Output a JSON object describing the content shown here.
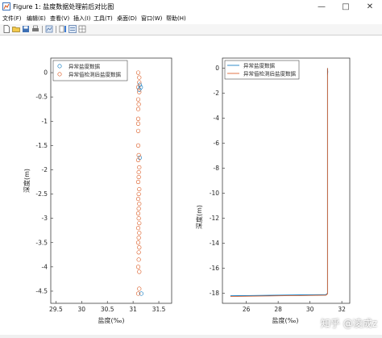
{
  "window": {
    "title": "Figure 1: 盐度数据处理前后对比图",
    "minimize": "—",
    "maximize": "□",
    "close": "✕"
  },
  "menu": [
    "文件(F)",
    "编辑(E)",
    "查看(V)",
    "插入(I)",
    "工具(T)",
    "桌面(D)",
    "窗口(W)",
    "帮助(H)"
  ],
  "toolbar_icons": [
    "new-file-icon",
    "open-folder-icon",
    "save-icon",
    "print-icon",
    "link-plot-icon",
    "insert-colorbar-icon",
    "insert-legend-icon",
    "grid-icon"
  ],
  "left_plot": {
    "xlabel": "盐度(‰)",
    "ylabel": "深度(m)",
    "xticks": [
      "29.5",
      "30",
      "30.5",
      "31",
      "31.5"
    ],
    "yticks": [
      "0",
      "-0.5",
      "-1",
      "-1.5",
      "-2",
      "-2.5",
      "-3",
      "-3.5",
      "-4",
      "-4.5"
    ],
    "legend": [
      "异常盐度数据",
      "异常值检测后盐度数据"
    ]
  },
  "right_plot": {
    "xlabel": "盐度(‰)",
    "ylabel": "深度(m)",
    "xticks": [
      "26",
      "28",
      "30",
      "32"
    ],
    "yticks": [
      "0",
      "-2",
      "-4",
      "-6",
      "-8",
      "-10",
      "-12",
      "-14",
      "-16",
      "-18"
    ],
    "legend": [
      "异常盐度数据",
      "异常值检测后盐度数据"
    ]
  },
  "watermark": "知乎 @凌成z",
  "colors": {
    "series_raw": "#0072bd",
    "series_cleaned": "#d95319",
    "axis": "#262626"
  },
  "chart_data": [
    {
      "type": "scatter",
      "xlabel": "盐度(‰)",
      "ylabel": "深度(m)",
      "xlim": [
        29.4,
        31.75
      ],
      "ylim": [
        -4.75,
        0.3
      ],
      "legend_position": "top-left",
      "series": [
        {
          "name": "异常盐度数据",
          "marker": "circle",
          "points": [
            [
              31.13,
              -0.25
            ],
            [
              31.15,
              -0.3
            ],
            [
              31.12,
              -0.35
            ],
            [
              31.13,
              -1.75
            ],
            [
              31.16,
              -4.55
            ]
          ]
        },
        {
          "name": "异常值检测后盐度数据",
          "marker": "circle",
          "points": [
            [
              31.1,
              0.0
            ],
            [
              31.12,
              -0.1
            ],
            [
              31.12,
              -0.2
            ],
            [
              31.1,
              -0.3
            ],
            [
              31.12,
              -0.4
            ],
            [
              31.1,
              -0.55
            ],
            [
              31.11,
              -0.65
            ],
            [
              31.1,
              -0.75
            ],
            [
              31.1,
              -0.95
            ],
            [
              31.1,
              -1.05
            ],
            [
              31.1,
              -1.2
            ],
            [
              31.1,
              -1.5
            ],
            [
              31.11,
              -1.7
            ],
            [
              31.1,
              -1.8
            ],
            [
              31.12,
              -1.95
            ],
            [
              31.11,
              -2.05
            ],
            [
              31.11,
              -2.15
            ],
            [
              31.1,
              -2.25
            ],
            [
              31.12,
              -2.4
            ],
            [
              31.11,
              -2.5
            ],
            [
              31.1,
              -2.6
            ],
            [
              31.12,
              -2.7
            ],
            [
              31.11,
              -2.8
            ],
            [
              31.1,
              -2.9
            ],
            [
              31.11,
              -3.0
            ],
            [
              31.12,
              -3.1
            ],
            [
              31.1,
              -3.2
            ],
            [
              31.12,
              -3.3
            ],
            [
              31.11,
              -3.4
            ],
            [
              31.1,
              -3.5
            ],
            [
              31.12,
              -3.6
            ],
            [
              31.11,
              -3.7
            ],
            [
              31.11,
              -3.85
            ],
            [
              31.1,
              -4.0
            ],
            [
              31.12,
              -4.1
            ],
            [
              31.12,
              -4.45
            ],
            [
              31.1,
              -4.55
            ]
          ]
        }
      ]
    },
    {
      "type": "line",
      "xlabel": "盐度(‰)",
      "ylabel": "深度(m)",
      "xlim": [
        24.5,
        32.5
      ],
      "ylim": [
        -18.8,
        0.8
      ],
      "legend_position": "top-left",
      "series": [
        {
          "name": "异常盐度数据",
          "points": [
            [
              25.0,
              -18.2
            ],
            [
              31.0,
              -18.1
            ],
            [
              31.1,
              -18.0
            ],
            [
              31.1,
              0.0
            ],
            [
              31.12,
              -0.3
            ],
            [
              31.1,
              -0.6
            ]
          ]
        },
        {
          "name": "异常值检测后盐度数据",
          "points": [
            [
              25.0,
              -18.25
            ],
            [
              31.0,
              -18.15
            ],
            [
              31.1,
              -18.05
            ],
            [
              31.1,
              0.0
            ]
          ]
        }
      ]
    }
  ]
}
